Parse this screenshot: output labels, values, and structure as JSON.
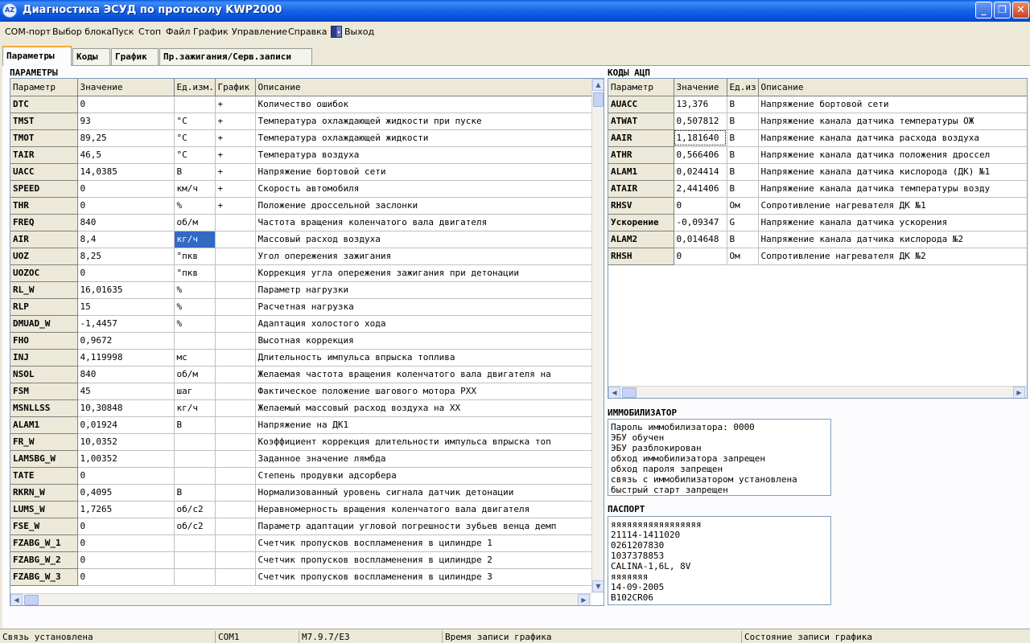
{
  "window": {
    "title": "Диагностика ЭСУД по протоколу KWP2000",
    "logo_text": "AZ"
  },
  "menu": {
    "items": [
      "COM-порт",
      "Выбор блока",
      "Пуск",
      "Стоп",
      "Файл",
      "График",
      "Управление",
      "Справка",
      "Выход"
    ]
  },
  "tabs": [
    "Параметры",
    "Коды",
    "График",
    "Пр.зажигания/Серв.записи"
  ],
  "params": {
    "title": "ПАРАМЕТРЫ",
    "columns": [
      "Параметр",
      "Значение",
      "Ед.изм.",
      "График",
      "Описание"
    ],
    "rows": [
      [
        "DTC",
        "0",
        "",
        "+",
        "Количество ошибок"
      ],
      [
        "TMST",
        "93",
        "°C",
        "+",
        "Температура охлаждающей жидкости при пуске"
      ],
      [
        "TMOT",
        "89,25",
        "°C",
        "+",
        "Температура охлаждающей жидкости"
      ],
      [
        "TAIR",
        "46,5",
        "°C",
        "+",
        "Температура воздуха"
      ],
      [
        "UACC",
        "14,0385",
        "B",
        "+",
        "Напряжение бортовой сети"
      ],
      [
        "SPEED",
        "0",
        "км/ч",
        "+",
        "Скорость автомобиля"
      ],
      [
        "THR",
        "0",
        "%",
        "+",
        "Положение дроссельной заслонки"
      ],
      [
        "FREQ",
        "840",
        "об/м",
        "",
        "Частота вращения коленчатого вала двигателя"
      ],
      [
        "AIR",
        "8,4",
        "кг/ч",
        "",
        "Массовый расход воздуха"
      ],
      [
        "UOZ",
        "8,25",
        "°пкв",
        "",
        "Угол опережения зажигания"
      ],
      [
        "UOZOC",
        "0",
        "°пкв",
        "",
        "Коррекция угла опережения зажигания при детонации"
      ],
      [
        "RL_W",
        "16,01635",
        "%",
        "",
        "Параметр нагрузки"
      ],
      [
        "RLP",
        "15",
        "%",
        "",
        "Расчетная нагрузка"
      ],
      [
        "DMUAD_W",
        "-1,4457",
        "%",
        "",
        "Адаптация холостого хода"
      ],
      [
        "FHO",
        "0,9672",
        "",
        "",
        "Высотная коррекция"
      ],
      [
        "INJ",
        "4,119998",
        "мс",
        "",
        "Длительность импульса впрыска топлива"
      ],
      [
        "NSOL",
        "840",
        "об/м",
        "",
        "Желаемая частота вращения коленчатого вала двигателя на"
      ],
      [
        "FSM",
        "45",
        "шаг",
        "",
        "Фактическое положение шагового мотора РХХ"
      ],
      [
        "MSNLLSS",
        "10,30848",
        "кг/ч",
        "",
        "Желаемый массовый расход воздуха на ХХ"
      ],
      [
        "ALAM1",
        "0,01924",
        "B",
        "",
        "Напряжение на ДК1"
      ],
      [
        "FR_W",
        "10,0352",
        "",
        "",
        "Коэффициент коррекция длительности импульса впрыска топ"
      ],
      [
        "LAMSBG_W",
        "1,00352",
        "",
        "",
        "Заданное значение лямбда"
      ],
      [
        "TATE",
        "0",
        "",
        "",
        "Степень продувки адсорбера"
      ],
      [
        "RKRN_W",
        "0,4095",
        "B",
        "",
        "Нормализованный уровень сигнала датчик детонации"
      ],
      [
        "LUMS_W",
        "1,7265",
        "об/с2",
        "",
        "Неравномерность вращения коленчатого вала двигателя"
      ],
      [
        "FSE_W",
        "0",
        "об/с2",
        "",
        "Параметр адаптации угловой погрешности зубьев венца демп"
      ],
      [
        "FZABG_W_1",
        "0",
        "",
        "",
        "Счетчик пропусков воспламенения в цилиндре 1"
      ],
      [
        "FZABG_W_2",
        "0",
        "",
        "",
        "Счетчик пропусков воспламенения в цилиндре 2"
      ],
      [
        "FZABG_W_3",
        "0",
        "",
        "",
        "Счетчик пропусков воспламенения в цилиндре 3"
      ]
    ],
    "selected_row": 8,
    "selected_col": 2
  },
  "adc": {
    "title": "КОДЫ АЦП",
    "columns": [
      "Параметр",
      "Значение",
      "Ед.из",
      "Описание"
    ],
    "rows": [
      [
        "AUACC",
        "13,376",
        "B",
        "Напряжение бортовой сети"
      ],
      [
        "ATWAT",
        "0,507812",
        "B",
        "Напряжение канала датчика температуры ОЖ"
      ],
      [
        "AAIR",
        "1,181640",
        "B",
        "Напряжение канала датчика расхода воздуха"
      ],
      [
        "ATHR",
        "0,566406",
        "B",
        "Напряжение канала датчика положения дроссел"
      ],
      [
        "ALAM1",
        "0,024414",
        "B",
        "Напряжение канала датчика кислорода (ДК) №1"
      ],
      [
        "ATAIR",
        "2,441406",
        "B",
        "Напряжение канала датчика температуры возду"
      ],
      [
        "RHSV",
        "0",
        "Ом",
        "Сопротивление нагревателя ДК №1"
      ],
      [
        "Ускорение",
        "-0,09347",
        "G",
        "Напряжение канала датчика ускорения"
      ],
      [
        "ALAM2",
        "0,014648",
        "B",
        "Напряжение канала датчика кислорода №2"
      ],
      [
        "RHSH",
        "0",
        "Ом",
        "Сопротивление нагревателя ДК №2"
      ]
    ],
    "focused_row": 2
  },
  "immobilizer": {
    "title": "ИММОБИЛИЗАТОР",
    "lines": [
      "Пароль иммобилизатора: 0000",
      "ЭБУ обучен",
      "ЭБУ разблокирован",
      "обход иммобилизатора запрещен",
      "обход пароля запрещен",
      "связь с иммобилизатором установлена",
      "быстрый старт запрещен"
    ]
  },
  "passport": {
    "title": "ПАСПОРТ",
    "lines": [
      "яяяяяяяяяяяяяяяяя",
      "21114-1411020",
      "0261207830",
      "1037378853",
      "CALINA-1,6L, 8V",
      "яяяяяяя",
      "14-09-2005",
      "B102CR06"
    ]
  },
  "status": {
    "connection": "Связь установлена",
    "port": "COM1",
    "ecu": "M7.9.7/E3",
    "record_time_label": "Время записи графика",
    "record_state_label": "Состояние записи графика"
  },
  "colors": {
    "selection": "#316ac5",
    "titlebar": "#0653dd",
    "window_bg": "#ece9d8"
  }
}
